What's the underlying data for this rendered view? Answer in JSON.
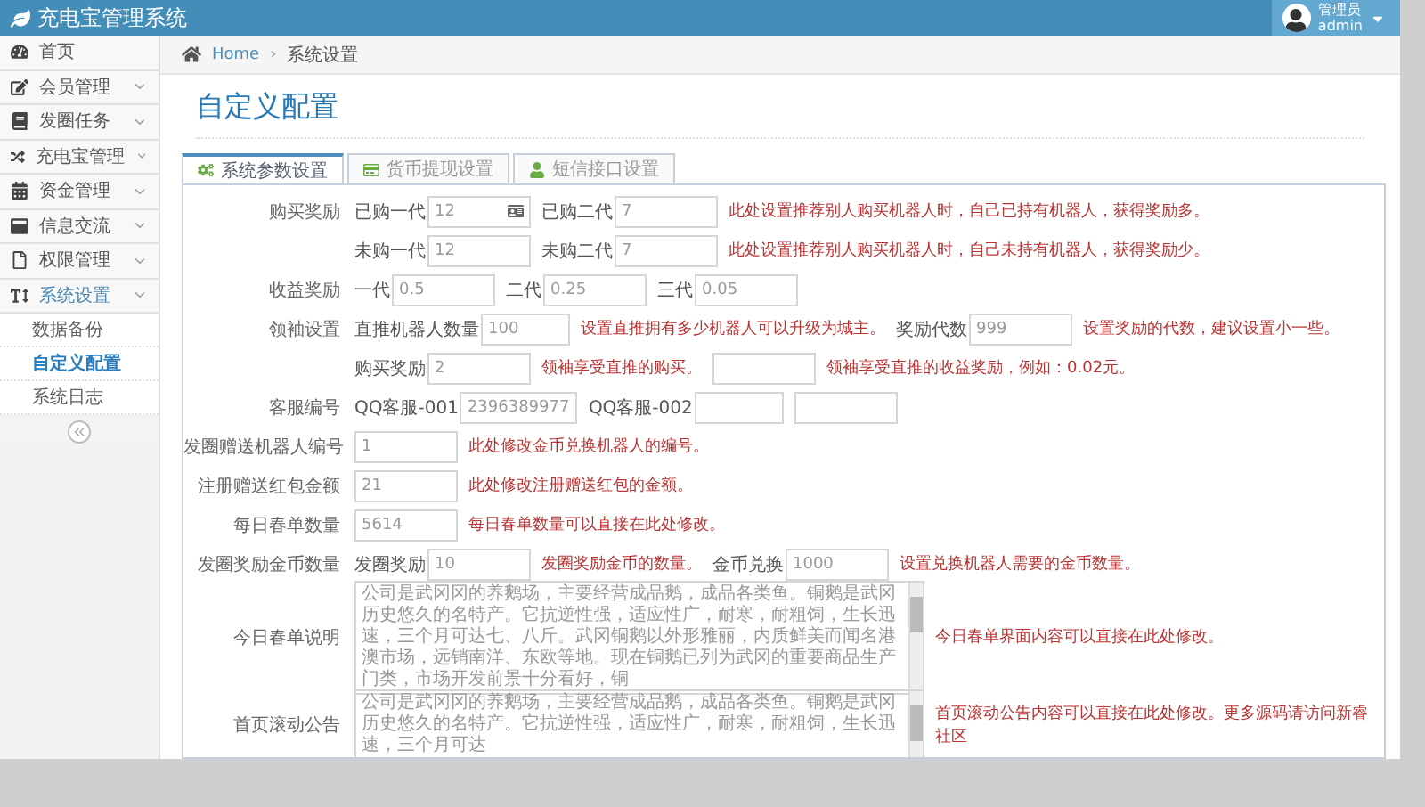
{
  "header": {
    "title": "充电宝管理系统",
    "user": {
      "role": "管理员",
      "name": "admin"
    }
  },
  "sidebar": {
    "items": [
      {
        "label": "首页",
        "selected": false
      },
      {
        "label": "会员管理",
        "selected": false
      },
      {
        "label": "发圈任务",
        "selected": false
      },
      {
        "label": "充电宝管理",
        "selected": false
      },
      {
        "label": "资金管理",
        "selected": false
      },
      {
        "label": "信息交流",
        "selected": false
      },
      {
        "label": "权限管理",
        "selected": false
      },
      {
        "label": "系统设置",
        "selected": true,
        "children": [
          {
            "label": "数据备份",
            "selected": false
          },
          {
            "label": "自定义配置",
            "selected": true
          },
          {
            "label": "系统日志",
            "selected": false
          }
        ]
      }
    ]
  },
  "breadcrumb": {
    "items": [
      "Home",
      "系统设置"
    ],
    "separator": "›"
  },
  "page_title": "自定义配置",
  "tabs": [
    {
      "label": "系统参数设置",
      "selected": true
    },
    {
      "label": "货币提现设置",
      "selected": false
    },
    {
      "label": "短信接口设置",
      "selected": false
    }
  ],
  "form": [
    {
      "label": "购买奖励",
      "kind": "fields",
      "items": [
        {
          "kind": "input_icon",
          "prefix": "已购一代",
          "value": "12"
        },
        {
          "kind": "input",
          "prefix": "已购二代",
          "value": "7"
        },
        {
          "kind": "hint",
          "text": "此处设置推荐别人购买机器人时，自己已持有机器人，获得奖励多。"
        }
      ]
    },
    {
      "kind": "fields",
      "items": [
        {
          "kind": "input",
          "prefix": "未购一代",
          "value": "12"
        },
        {
          "kind": "input",
          "prefix": "未购二代",
          "value": "7"
        },
        {
          "kind": "hint",
          "text": "此处设置推荐别人购买机器人时，自己未持有机器人，获得奖励少。"
        }
      ]
    },
    {
      "label": "收益奖励",
      "kind": "fields",
      "items": [
        {
          "kind": "input",
          "prefix": "一代",
          "value": "0.5"
        },
        {
          "kind": "input",
          "prefix": "二代",
          "value": "0.25"
        },
        {
          "kind": "input",
          "prefix": "三代",
          "value": "0.05"
        }
      ]
    },
    {
      "label": "领袖设置",
      "kind": "fields",
      "items": [
        {
          "kind": "input",
          "prefix": "直推机器人数量",
          "value": "100"
        },
        {
          "kind": "hint",
          "text": "设置直推拥有多少机器人可以升级为城主。"
        },
        {
          "kind": "input",
          "prefix": "奖励代数",
          "value": "999"
        },
        {
          "kind": "hint",
          "text": "设置奖励的代数，建议设置小一些。"
        }
      ]
    },
    {
      "kind": "fields",
      "items": [
        {
          "kind": "input",
          "prefix": "购买奖励",
          "value": "2"
        },
        {
          "kind": "hint",
          "text": "领袖享受直推的购买。"
        },
        {
          "kind": "input"
        },
        {
          "kind": "hint",
          "text": "领袖享受直推的收益奖励，例如：0.02元。"
        }
      ]
    },
    {
      "label": "客服编号",
      "kind": "fields",
      "items": [
        {
          "kind": "input",
          "prefix": "QQ客服-001",
          "value": "2396389977"
        },
        {
          "kind": "input",
          "prefix": "QQ客服-002"
        },
        {
          "kind": "input"
        }
      ]
    },
    {
      "label": "发圈赠送机器人编号",
      "kind": "fields",
      "items": [
        {
          "kind": "input",
          "value": "1"
        },
        {
          "kind": "hint",
          "text": "此处修改金币兑换机器人的编号。"
        }
      ]
    },
    {
      "label": "注册赠送红包金额",
      "kind": "fields",
      "items": [
        {
          "kind": "input",
          "value": "21"
        },
        {
          "kind": "hint",
          "text": "此处修改注册赠送红包的金额。"
        }
      ]
    },
    {
      "label": "每日春单数量",
      "kind": "fields",
      "items": [
        {
          "kind": "input",
          "value": "5614"
        },
        {
          "kind": "hint",
          "text": "每日春单数量可以直接在此处修改。"
        }
      ]
    },
    {
      "label": "发圈奖励金币数量",
      "kind": "fields",
      "items": [
        {
          "kind": "input",
          "prefix": "发圈奖励",
          "value": "10"
        },
        {
          "kind": "hint",
          "text": "发圈奖励金币的数量。"
        },
        {
          "kind": "input",
          "prefix": "金币兑换",
          "value": "1000"
        },
        {
          "kind": "hint",
          "text": "设置兑换机器人需要的金币数量。"
        }
      ]
    },
    {
      "label": "今日春单说明",
      "kind": "textarea",
      "value": "公司是武冈冈的养鹅场，主要经营成品鹅，成品各类鱼。铜鹅是武冈历史悠久的名特产。它抗逆性强，适应性广，耐寒，耐粗饲，生长迅速，三个月可达七、八斤。武冈铜鹅以外形雅丽，内质鲜美而闻名港澳市场，远销南洋、东欧等地。现在铜鹅已列为武冈的重要商品生产门类，市场开发前景十分看好，铜",
      "hint": "今日春单界面内容可以直接在此处修改。"
    },
    {
      "label": "首页滚动公告",
      "kind": "textarea",
      "value": "公司是武冈冈的养鹅场，主要经营成品鹅，成品各类鱼。铜鹅是武冈历史悠久的名特产。它抗逆性强，适应性广，耐寒，耐粗饲，生长迅速，三个月可达",
      "hint": "首页滚动公告内容可以直接在此处修改。更多源码请访问新睿社区"
    }
  ]
}
